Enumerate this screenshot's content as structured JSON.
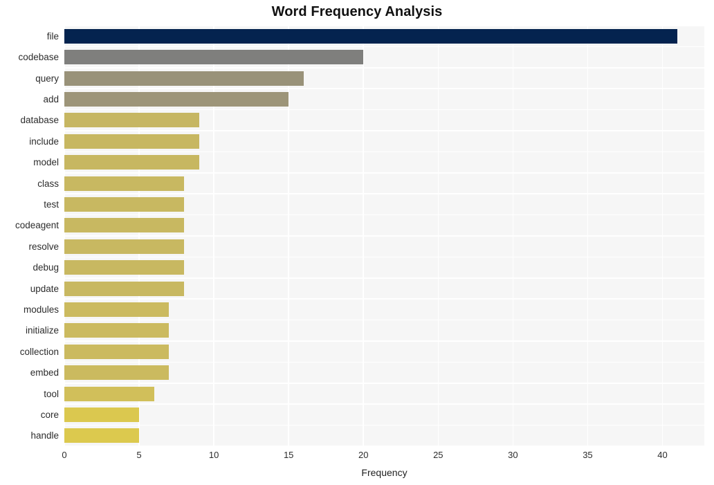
{
  "chart_data": {
    "type": "bar",
    "orientation": "horizontal",
    "title": "Word Frequency Analysis",
    "xlabel": "Frequency",
    "ylabel": "",
    "categories": [
      "file",
      "codebase",
      "query",
      "add",
      "database",
      "include",
      "model",
      "class",
      "test",
      "codeagent",
      "resolve",
      "debug",
      "update",
      "modules",
      "initialize",
      "collection",
      "embed",
      "tool",
      "core",
      "handle"
    ],
    "values": [
      41,
      20,
      16,
      15,
      9,
      9,
      9,
      8,
      8,
      8,
      8,
      8,
      8,
      7,
      7,
      7,
      7,
      6,
      5,
      5
    ],
    "bar_colors": [
      "#04234f",
      "#7f7f7d",
      "#999279",
      "#9d9579",
      "#c6b662",
      "#c7b761",
      "#c7b761",
      "#c8b861",
      "#c8b861",
      "#c8b861",
      "#c8b861",
      "#c8b861",
      "#c8b861",
      "#cbba5f",
      "#cbba5f",
      "#cbba5f",
      "#cbba5f",
      "#d1bf5a",
      "#dbc84f",
      "#dcc94e"
    ],
    "xlim": [
      0,
      42.8
    ],
    "ylim_count": 20,
    "xticks": [
      0,
      5,
      10,
      15,
      20,
      25,
      30,
      35,
      40
    ],
    "xtick_labels": [
      "0",
      "5",
      "10",
      "15",
      "20",
      "25",
      "30",
      "35",
      "40"
    ],
    "grid": true,
    "grid_color": "#ffffff",
    "plot_background": "#f6f6f6",
    "figure_background": "#ffffff",
    "legend": null
  }
}
